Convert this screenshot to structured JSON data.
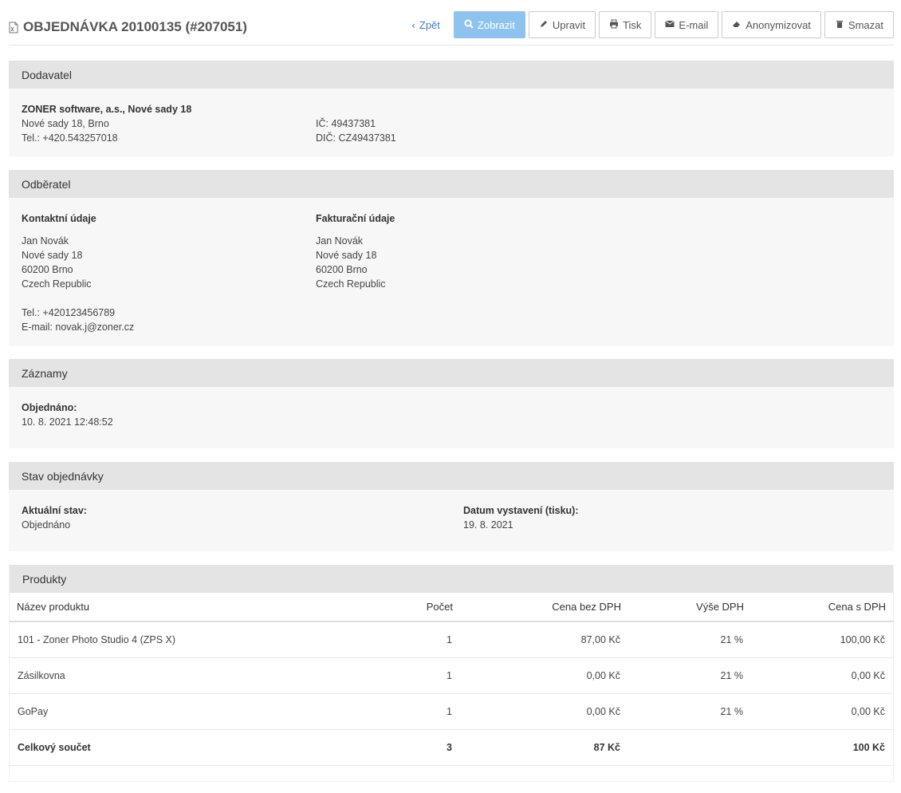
{
  "header": {
    "title": "OBJEDNÁVKA 20100135 (#207051)",
    "buttons": {
      "back": "Zpět",
      "view": "Zobrazit",
      "edit": "Upravit",
      "print": "Tisk",
      "email": "E-mail",
      "anonymize": "Anonymizovat",
      "delete": "Smazat"
    }
  },
  "supplier": {
    "heading": "Dodavatel",
    "name": "ZONER software, a.s., Nové sady 18",
    "address": "Nové sady 18, Brno",
    "phone": "Tel.: +420.543257018",
    "ic": "IČ: 49437381",
    "dic": "DIČ: CZ49437381"
  },
  "customer": {
    "heading": "Odběratel",
    "contact": {
      "heading": "Kontaktní údaje",
      "name": "Jan Novák",
      "street": "Nové sady 18",
      "city": "60200 Brno",
      "country": "Czech Republic",
      "phone": "Tel.: +420123456789",
      "email": "E-mail: novak.j@zoner.cz"
    },
    "billing": {
      "heading": "Fakturační údaje",
      "name": "Jan Novák",
      "street": "Nové sady 18",
      "city": "60200 Brno",
      "country": "Czech Republic"
    }
  },
  "records": {
    "heading": "Záznamy",
    "ordered_label": "Objednáno:",
    "ordered_value": "10. 8. 2021 12:48:52"
  },
  "status": {
    "heading": "Stav objednávky",
    "current_label": "Aktuální stav:",
    "current_value": "Objednáno",
    "issued_label": "Datum vystavení (tisku):",
    "issued_value": "19. 8. 2021"
  },
  "products": {
    "heading": "Produkty",
    "columns": [
      "Název produktu",
      "Počet",
      "Cena bez DPH",
      "Výše DPH",
      "Cena s DPH"
    ],
    "rows": [
      [
        "101 - Zoner Photo Studio 4 (ZPS X)",
        "1",
        "87,00 Kč",
        "21 %",
        "100,00 Kč"
      ],
      [
        "Zásilkovna",
        "1",
        "0,00 Kč",
        "21 %",
        "0,00 Kč"
      ],
      [
        "GoPay",
        "1",
        "0,00 Kč",
        "21 %",
        "0,00 Kč"
      ]
    ],
    "total": [
      "Celkový součet",
      "3",
      "87 Kč",
      "",
      "100 Kč"
    ]
  }
}
